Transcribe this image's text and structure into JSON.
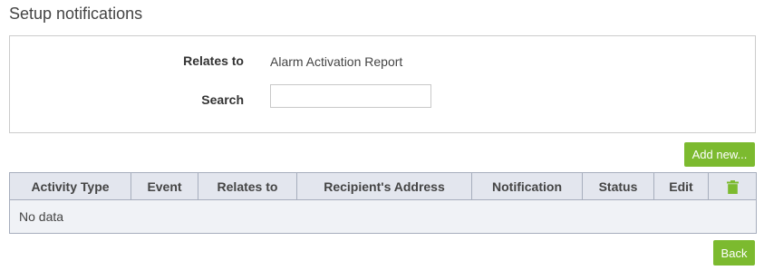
{
  "page": {
    "title": "Setup notifications"
  },
  "filters": {
    "relates_to_label": "Relates to",
    "relates_to_value": "Alarm Activation Report",
    "search_label": "Search",
    "search_value": "",
    "search_placeholder": ""
  },
  "toolbar": {
    "add_new_label": "Add new..."
  },
  "table": {
    "columns": [
      "Activity Type",
      "Event",
      "Relates to",
      "Recipient's Address",
      "Notification",
      "Status",
      "Edit"
    ],
    "delete_column_icon": "trash-icon",
    "rows": [],
    "empty_text": "No data"
  },
  "footer": {
    "back_label": "Back"
  },
  "colors": {
    "accent_green": "#7cba2f",
    "header_bg": "#e3e6ee",
    "row_bg": "#f0f2f6",
    "border": "#a7aebd"
  }
}
